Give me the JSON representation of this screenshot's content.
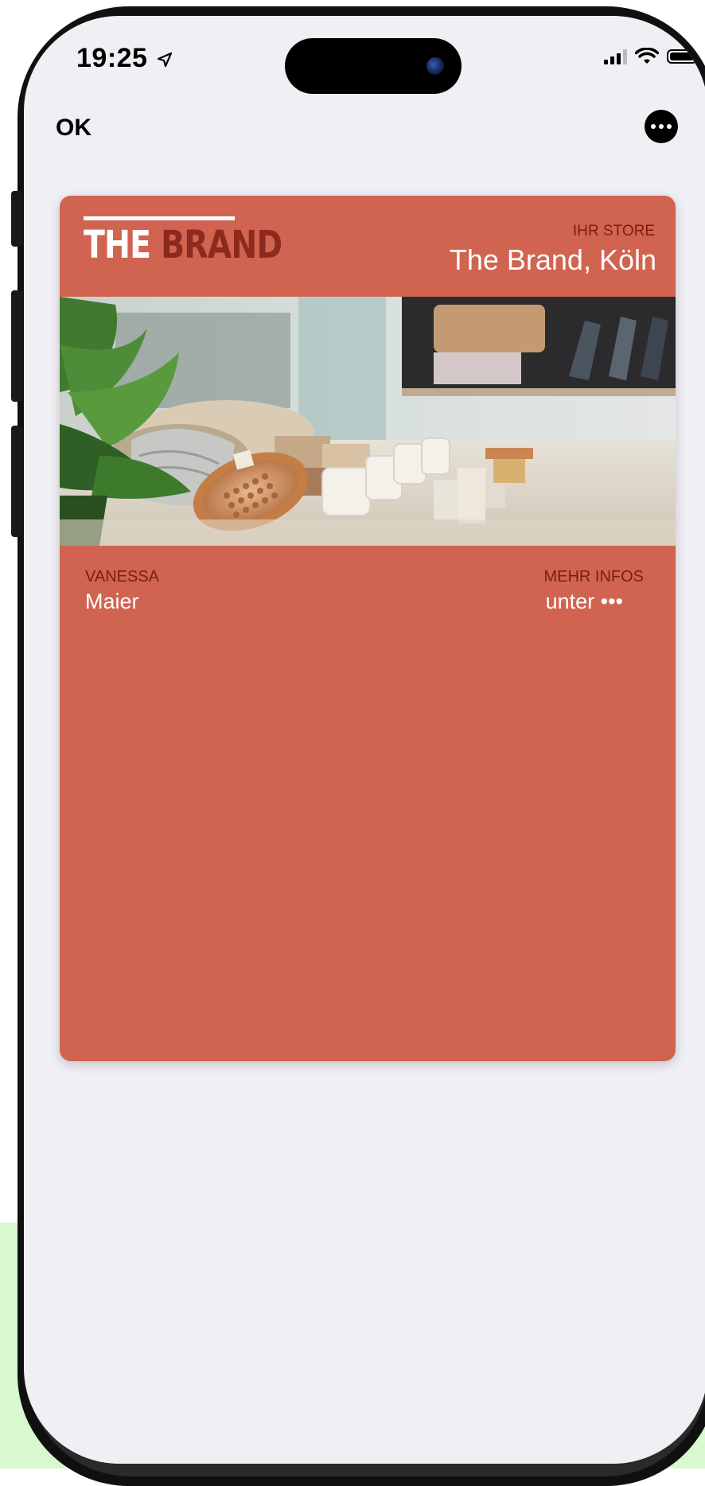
{
  "status_bar": {
    "time": "19:25",
    "location_icon": "location-arrow-icon",
    "signal_icon": "cellular-signal-icon",
    "wifi_icon": "wifi-icon",
    "battery_icon": "battery-icon"
  },
  "nav": {
    "ok_label": "OK",
    "more_icon": "ellipsis-circle-icon"
  },
  "card": {
    "background_color": "#d06450",
    "logo_the": "THE",
    "logo_brand": "BRAND",
    "store_label": "IHR STORE",
    "store_value": "The Brand, Köln",
    "holder_label": "VANESSA",
    "holder_value": "Maier",
    "info_label": "MEHR INFOS",
    "info_value": "unter •••"
  },
  "colors": {
    "screen_bg": "#efeff4",
    "card_accent_text": "#7a1e12",
    "page_green": "#d8f8d0"
  }
}
